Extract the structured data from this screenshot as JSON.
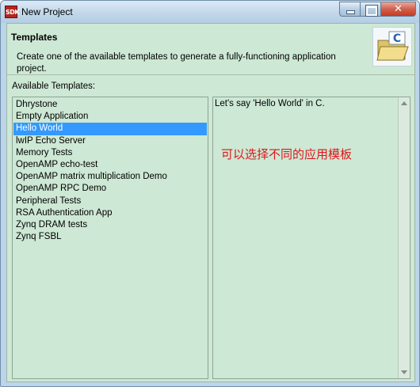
{
  "window": {
    "title": "New Project",
    "app_icon_text": "SDK",
    "controls": {
      "minimize": "minimize",
      "maximize": "maximize",
      "close": "✕"
    }
  },
  "header": {
    "title": "Templates",
    "description": "Create one of the available templates to generate a fully-functioning application project.",
    "icon": "folder-c-icon"
  },
  "templates": {
    "label": "Available Templates:",
    "items": [
      "Dhrystone",
      "Empty Application",
      "Hello World",
      "lwIP Echo Server",
      "Memory Tests",
      "OpenAMP echo-test",
      "OpenAMP matrix multiplication Demo",
      "OpenAMP RPC Demo",
      "Peripheral Tests",
      "RSA Authentication App",
      "Zynq DRAM tests",
      "Zynq FSBL"
    ],
    "selected": "Hello World"
  },
  "description_panel": {
    "text": "Let's say 'Hello World' in C.",
    "annotation": "可以选择不同的应用模板"
  },
  "colors": {
    "panel_bg": "#cde8d4",
    "selection": "#3399ff",
    "annotation": "#e0161c"
  }
}
